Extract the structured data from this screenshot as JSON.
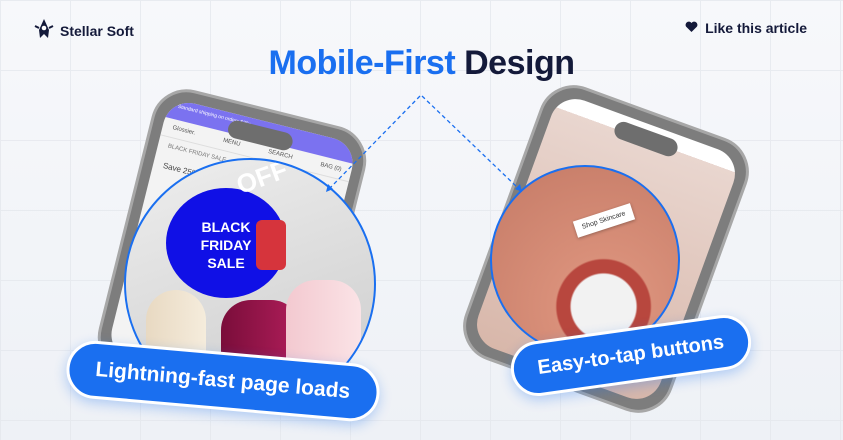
{
  "brand": {
    "name": "Stellar Soft",
    "logo_icon": "rocket-icon"
  },
  "like": {
    "label": "Like this article",
    "icon": "heart-icon"
  },
  "title": {
    "accent": "Mobile-First",
    "rest": "Design"
  },
  "left_phone": {
    "promo": "Standard shipping on orders $30+",
    "nav": [
      "Glossier.",
      "MENU",
      "SEARCH",
      "BAG (0)"
    ],
    "eyebrow": "BLACK FRIDAY SALE",
    "headline": "Save 25% + unlock 30% off on"
  },
  "left_circle": {
    "badge": "BLACK FRIDAY SALE",
    "off": "OFF"
  },
  "right_circle": {
    "button": "Shop Skincare"
  },
  "callouts": {
    "left": "Lightning-fast page loads",
    "right": "Easy-to-tap buttons"
  },
  "colors": {
    "accent": "#1a6ff0",
    "dark": "#141a3a",
    "sale": "#1010e6"
  }
}
